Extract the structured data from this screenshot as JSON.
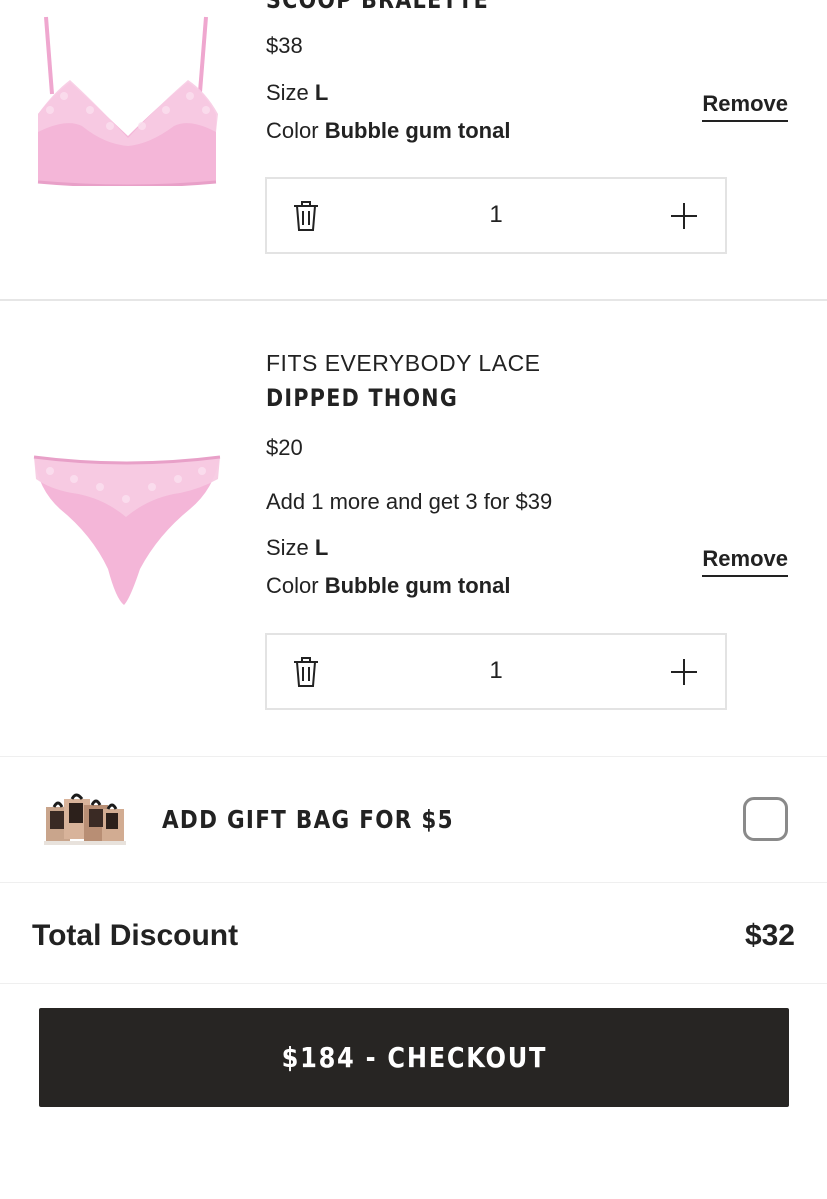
{
  "cart": {
    "items": [
      {
        "line": "",
        "name": "SCOOP BRALETTE",
        "price": "$38",
        "promo": "",
        "size_label": "Size",
        "size": "L",
        "color_label": "Color",
        "color": "Bubble gum tonal",
        "remove_label": "Remove",
        "quantity": "1",
        "image": "pink-lace-bralette"
      },
      {
        "line": "FITS EVERYBODY LACE",
        "name": "DIPPED THONG",
        "price": "$20",
        "promo": "Add 1 more and get 3 for $39",
        "size_label": "Size",
        "size": "L",
        "color_label": "Color",
        "color": "Bubble gum tonal",
        "remove_label": "Remove",
        "quantity": "1",
        "image": "pink-lace-thong"
      }
    ],
    "icons": {
      "trash": "trash-icon",
      "plus": "plus-icon"
    }
  },
  "gift_bag": {
    "label": "ADD GIFT BAG FOR $5",
    "checked": false,
    "image": "gift-bag-bundle"
  },
  "discount": {
    "label": "Total Discount",
    "value": "$32"
  },
  "checkout": {
    "label": "$184 - CHECKOUT"
  },
  "colors": {
    "text": "#222222",
    "button_bg": "#272523",
    "button_text": "#ffffff",
    "product_pink": "#f4b6d8",
    "border": "#e3e3e3"
  }
}
